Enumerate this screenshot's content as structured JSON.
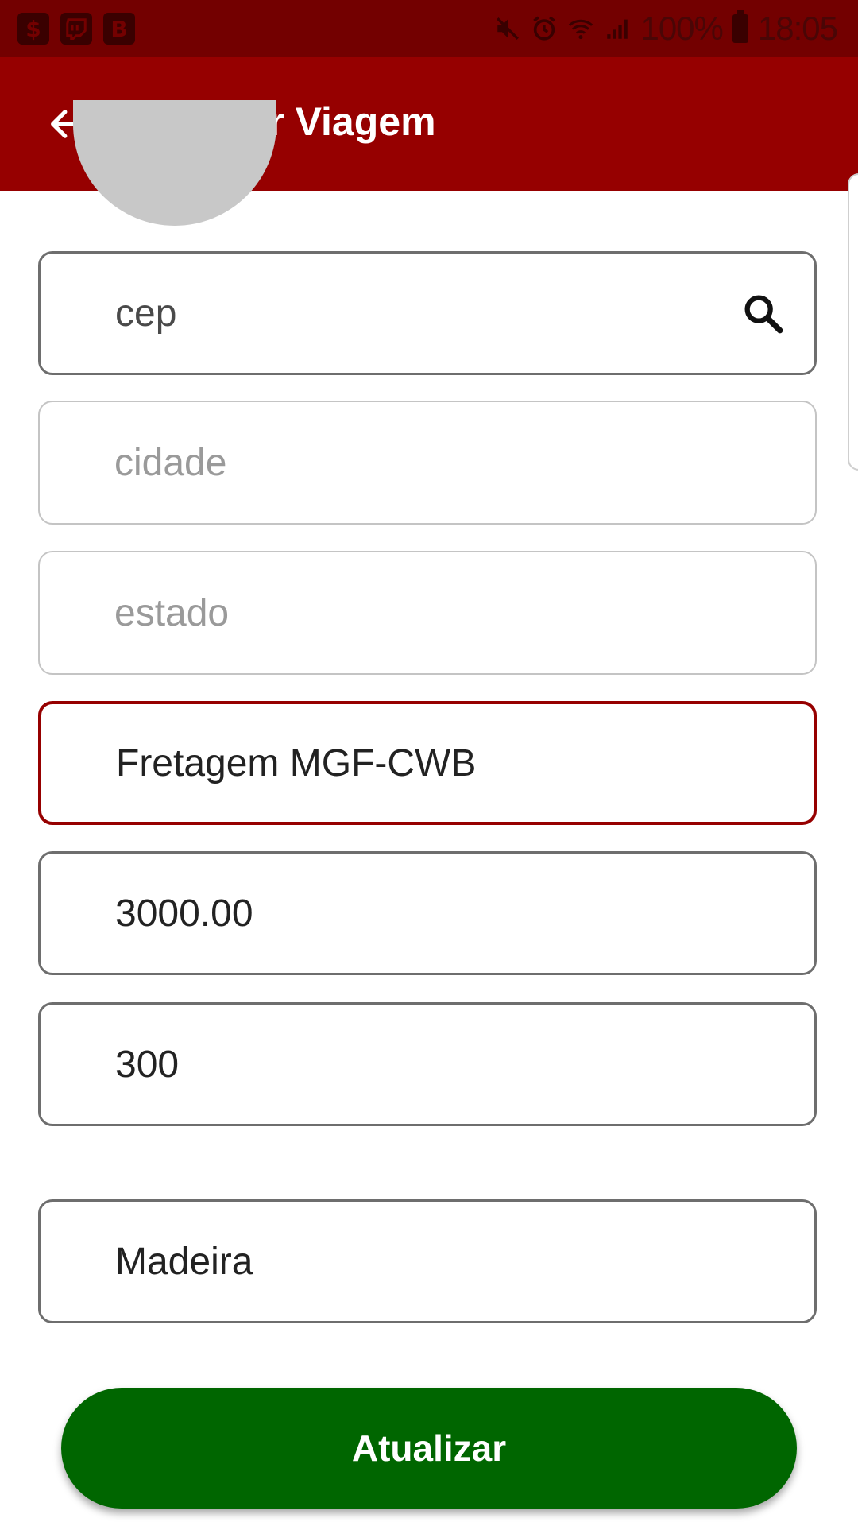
{
  "status_bar": {
    "notification_icons": [
      "shopping-bag-icon",
      "twitch-icon",
      "b-app-icon"
    ],
    "system_icons": [
      "mute-icon",
      "alarm-icon",
      "wifi-icon",
      "signal-icon"
    ],
    "battery": "100%",
    "time": "18:05"
  },
  "app_bar": {
    "title": "Editar Viagem",
    "back_icon": "arrow-back-icon",
    "color": "#960000"
  },
  "form": {
    "cep": {
      "placeholder": "cep",
      "value": "",
      "icon": "search-icon"
    },
    "cidade": {
      "placeholder": "cidade",
      "value": ""
    },
    "estado": {
      "placeholder": "estado",
      "value": ""
    },
    "descricao": {
      "value": "Fretagem MGF-CWB"
    },
    "valor": {
      "value": "3000.00"
    },
    "distancia": {
      "value": "300"
    },
    "carga": {
      "value": "Madeira"
    }
  },
  "update_button": {
    "label": "Atualizar",
    "color": "#006600"
  }
}
